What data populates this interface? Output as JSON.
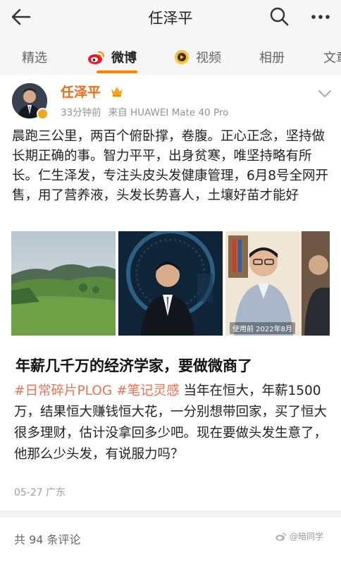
{
  "header": {
    "title": "任泽平"
  },
  "tabs": [
    {
      "label": "精选"
    },
    {
      "label": "微博"
    },
    {
      "label": "视频"
    },
    {
      "label": "相册"
    },
    {
      "label": "文章"
    }
  ],
  "post": {
    "author": "任泽平",
    "time": "33分钟前",
    "source": "来自 HUAWEI Mate 40 Pro",
    "text": "晨跑三公里，两百个俯卧撑，卷腹。正心正念，坚持做长期正确的事。智力平平，出身贫寒，唯坚持略有所长。仁生泽发，专注头皮头发健康管理，6月8号全网开售，用了营养液，头发长势喜人，土壤好苗才能好",
    "images": [
      {
        "caption": ""
      },
      {
        "caption": ""
      },
      {
        "caption": "使用前 2022年8月"
      }
    ]
  },
  "article": {
    "headline": "年薪几千万的经济学家，要做微商了",
    "hashtag1": "#日常碎片PLOG",
    "hashtag2": "#笔记灵感",
    "body": "当年在恒大，年薪1500万，结果恒大赚钱恒大花，一分别想带回家，买了恒大很多理财，估计没拿回多少吧。现在要做头发生意了，他那么少头发，有说服力吗？",
    "date_location": "05-27 广东"
  },
  "comments": {
    "count_text": "共 94 条评论"
  },
  "watermark": {
    "text": "@暗同学"
  },
  "colors": {
    "accent": "#ff8200",
    "username": "#ea6d1c",
    "hashtag": "#eb7350"
  }
}
